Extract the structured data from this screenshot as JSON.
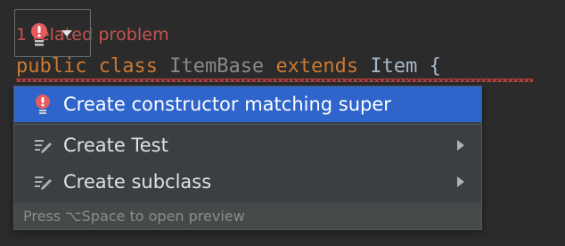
{
  "editor": {
    "problem_text": "1 related problem",
    "code": {
      "public_kw": "public",
      "class_kw": "class",
      "class_name": "ItemBase",
      "extends_kw": "extends",
      "parent_name": "Item",
      "brace": "{"
    }
  },
  "intention_popup": {
    "items": [
      {
        "label": "Create constructor matching super",
        "icon": "error-bulb-icon",
        "selected": true,
        "has_submenu": false
      },
      {
        "label": "Create Test",
        "icon": "edit-intention-icon",
        "selected": false,
        "has_submenu": true
      },
      {
        "label": "Create subclass",
        "icon": "edit-intention-icon",
        "selected": false,
        "has_submenu": true
      }
    ],
    "footer": "Press ⌥Space to open preview"
  },
  "colors": {
    "background": "#2b2b2b",
    "keyword": "#cc7832",
    "identifier": "#a9b7c6",
    "error": "#c75450",
    "selection": "#2f65ca",
    "popup_bg": "#3c3f41"
  }
}
